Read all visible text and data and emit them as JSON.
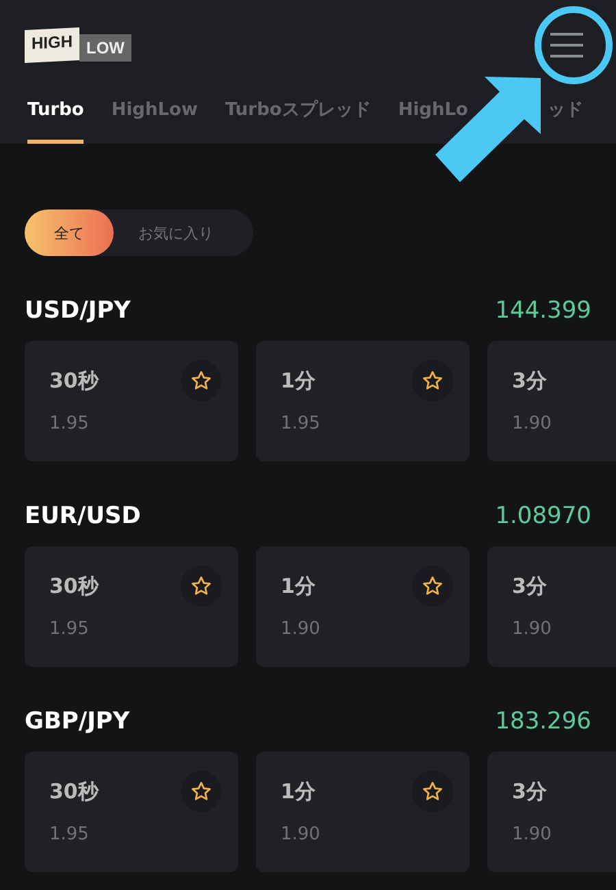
{
  "header": {
    "logo": {
      "left": "HIGH",
      "right": "LOW"
    }
  },
  "tabs": [
    {
      "label": "Turbo",
      "selected": true
    },
    {
      "label": "HighLow",
      "selected": false
    },
    {
      "label": "Turboスプレッド",
      "selected": false
    },
    {
      "label": "HighLo",
      "label_tail": "ッド",
      "selected": false
    }
  ],
  "filter": [
    {
      "label": "全て",
      "selected": true
    },
    {
      "label": "お気に入り",
      "selected": false
    }
  ],
  "markets": [
    {
      "pair": "USD/JPY",
      "price": "144.399",
      "options": [
        {
          "duration": "30秒",
          "payout": "1.95",
          "star": true
        },
        {
          "duration": "1分",
          "payout": "1.95",
          "star": true
        },
        {
          "duration": "3分",
          "payout": "1.90"
        }
      ]
    },
    {
      "pair": "EUR/USD",
      "price": "1.08970",
      "options": [
        {
          "duration": "30秒",
          "payout": "1.95",
          "star": true
        },
        {
          "duration": "1分",
          "payout": "1.90",
          "star": true
        },
        {
          "duration": "3分",
          "payout": "1.90"
        }
      ]
    },
    {
      "pair": "GBP/JPY",
      "price": "183.296",
      "options": [
        {
          "duration": "30秒",
          "payout": "1.95",
          "star": true
        },
        {
          "duration": "1分",
          "payout": "1.90",
          "star": true
        },
        {
          "duration": "3分",
          "payout": "1.90"
        }
      ]
    }
  ]
}
